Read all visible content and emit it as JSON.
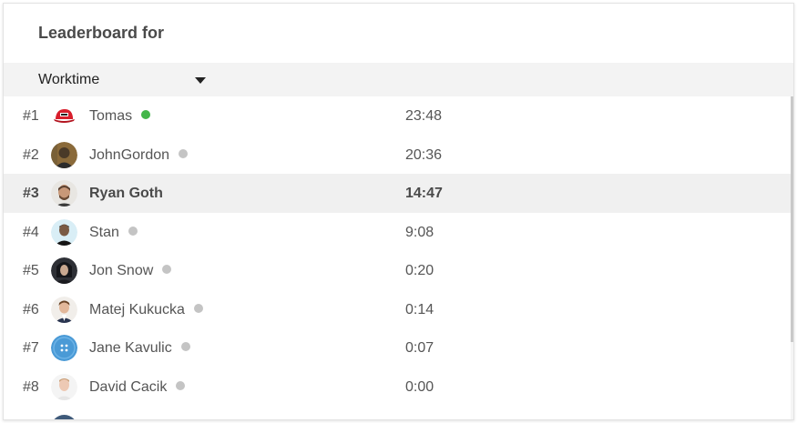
{
  "header": {
    "title": "Leaderboard for"
  },
  "filter": {
    "selected": "Worktime"
  },
  "colors": {
    "online": "#43b649",
    "offline": "#c4c4c4",
    "highlight_row": "#f0f0f0"
  },
  "leaderboard": {
    "rows": [
      {
        "rank": "#1",
        "name": "Tomas",
        "time": "23:48",
        "status": "online",
        "avatar": "red-cap-avatar"
      },
      {
        "rank": "#2",
        "name": "JohnGordon",
        "time": "20:36",
        "status": "offline",
        "avatar": "photo-avatar"
      },
      {
        "rank": "#3",
        "name": "Ryan Goth",
        "time": "14:47",
        "status": "none",
        "avatar": "photo-avatar",
        "highlighted": true
      },
      {
        "rank": "#4",
        "name": "Stan",
        "time": "9:08",
        "status": "offline",
        "avatar": "photo-avatar"
      },
      {
        "rank": "#5",
        "name": "Jon Snow",
        "time": "0:20",
        "status": "offline",
        "avatar": "photo-avatar"
      },
      {
        "rank": "#6",
        "name": "Matej Kukucka",
        "time": "0:14",
        "status": "offline",
        "avatar": "photo-avatar"
      },
      {
        "rank": "#7",
        "name": "Jane Kavulic",
        "time": "0:07",
        "status": "offline",
        "avatar": "blue-button-avatar"
      },
      {
        "rank": "#8",
        "name": "David Cacik",
        "time": "0:00",
        "status": "offline",
        "avatar": "photo-avatar"
      }
    ]
  }
}
